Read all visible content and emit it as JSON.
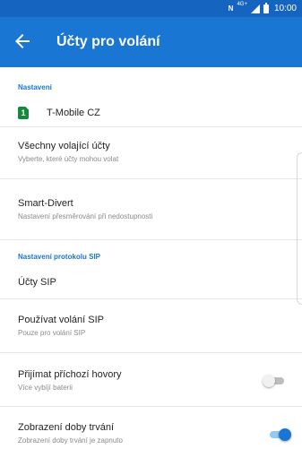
{
  "status_bar": {
    "nfc": "N",
    "network": "4G+",
    "time": "10:00"
  },
  "app_bar": {
    "title": "Účty pro volání",
    "back_icon": "arrow-back-icon"
  },
  "sections": {
    "settings_header": "Nastavení",
    "sip_header": "Nastavení protokolu SIP"
  },
  "sim": {
    "slot_number": "1",
    "label": "T-Mobile CZ",
    "color": "#138a3a"
  },
  "rows": {
    "all_accounts": {
      "title": "Všechny volající účty",
      "subtitle": "Vyberte, které účty mohou volat"
    },
    "smart_divert": {
      "title": "Smart-Divert",
      "subtitle": "Nastavení přesměrování při nedostupnosti"
    },
    "sip_accounts": {
      "title": "Účty SIP"
    },
    "use_sip": {
      "title": "Používat volání SIP",
      "subtitle": "Pouze pro volání SIP"
    },
    "incoming_calls": {
      "title": "Přijímat příchozí hovory",
      "subtitle": "Více vybíjí baterii",
      "enabled": false
    },
    "call_duration": {
      "title": "Zobrazení doby trvání",
      "subtitle": "Zobrazení doby trvání je zapnuto",
      "enabled": true
    }
  },
  "colors": {
    "status_bar": "#1565C0",
    "app_bar": "#1976D2",
    "accent": "#1976D2"
  }
}
